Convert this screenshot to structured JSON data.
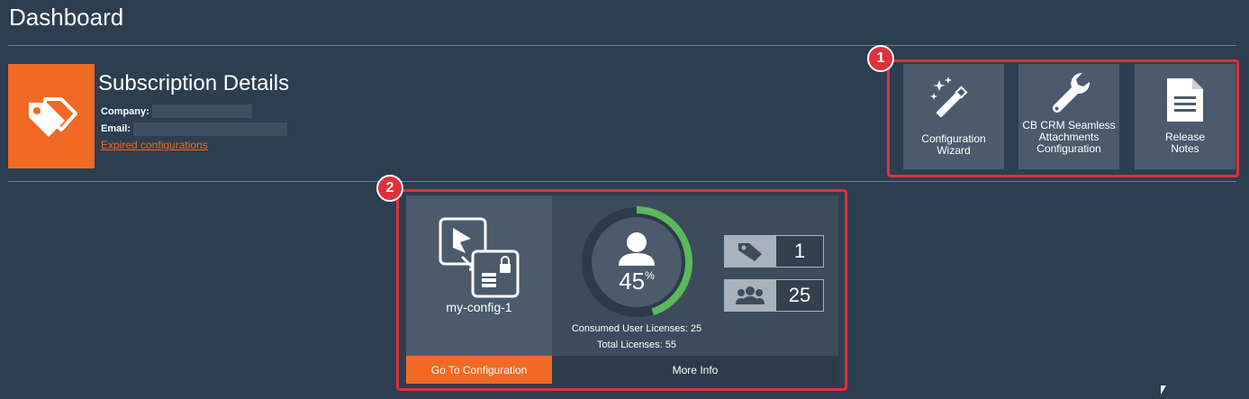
{
  "page": {
    "title": "Dashboard"
  },
  "subscription": {
    "title": "Subscription Details",
    "company_label": "Company:",
    "email_label": "Email:",
    "expired_link": "Expired configurations",
    "icon": "tags-icon"
  },
  "quick_links": {
    "badge": "1",
    "items": [
      {
        "label": "Configuration Wizard",
        "icon": "magic-wand-icon"
      },
      {
        "label": "CB CRM Seamless Attachments Configuration",
        "icon": "wrench-icon"
      },
      {
        "label": "Release Notes",
        "icon": "document-icon"
      }
    ]
  },
  "config_card": {
    "badge": "2",
    "name": "my-config-1",
    "go_button": "Go To Configuration",
    "more_info": "More Info",
    "license_percent": "45",
    "license_percent_fraction": 0.45,
    "percent_sign": "%",
    "consumed_label": "Consumed User Licenses: 25",
    "total_label": "Total Licenses: 55",
    "stats": [
      {
        "icon": "tag-icon",
        "value": "1"
      },
      {
        "icon": "users-icon",
        "value": "25"
      }
    ]
  },
  "colors": {
    "background": "#2c3e50",
    "accent_orange": "#f06a25",
    "highlight_red": "#e0303c",
    "progress_green": "#5cb85c"
  }
}
